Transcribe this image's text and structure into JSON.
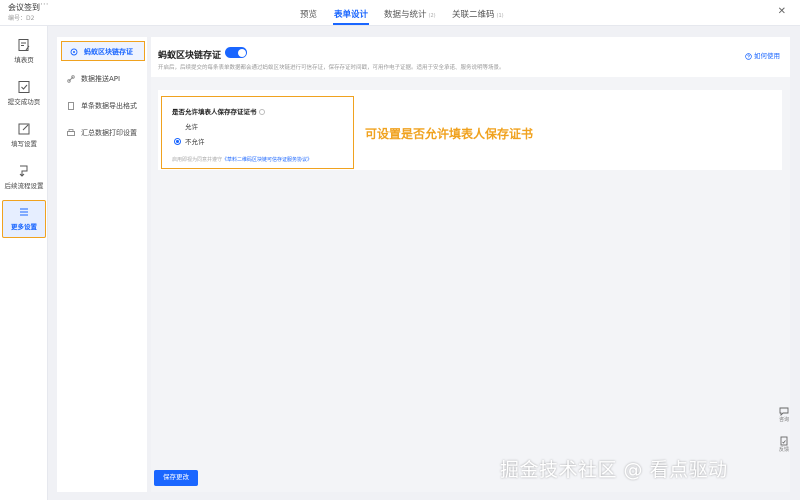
{
  "app": {
    "title": "会议签到",
    "more": "···",
    "subtitle": "编号：D2"
  },
  "tabs": [
    {
      "label": "预览",
      "badge": ""
    },
    {
      "label": "表单设计",
      "badge": ""
    },
    {
      "label": "数据与统计",
      "badge": "(2)"
    },
    {
      "label": "关联二维码",
      "badge": "(1)"
    }
  ],
  "close_glyph": "✕",
  "rail": [
    {
      "label": "填表页",
      "icon": "form-edit-icon"
    },
    {
      "label": "提交成功页",
      "icon": "success-page-icon"
    },
    {
      "label": "填写设置",
      "icon": "edit-settings-icon"
    },
    {
      "label": "后续流程设置",
      "icon": "flow-icon"
    },
    {
      "label": "更多设置",
      "icon": "menu-icon",
      "active": true
    }
  ],
  "submenu": [
    {
      "label": "蚂蚁区块链存证",
      "icon": "blockchain-icon",
      "active": true
    },
    {
      "label": "数据推送API",
      "icon": "link-icon"
    },
    {
      "label": "单条数据导出格式",
      "icon": "document-icon"
    },
    {
      "label": "汇总数据打印设置",
      "icon": "print-icon"
    }
  ],
  "section": {
    "title": "蚂蚁区块链存证",
    "enabled": true,
    "description": "开启后，后续提交的每条表单数据都会通过蚂蚁区块链进行可信存证，保存存证时间戳，可用作电子证据。适用于安全承诺、服务说明等场景。",
    "help": "如何使用"
  },
  "question": {
    "label": "是否允许填表人保存存证证书",
    "options": [
      "允许",
      "不允许"
    ],
    "selected": "不允许",
    "agree_prefix": "启用即视为同意并遵守",
    "agree_link": "《草料二维码区块链可信存证服务协议》"
  },
  "annotation": "可设置是否允许填表人保存证书",
  "save_button": "保存更改",
  "float_tools": [
    {
      "label": "咨询",
      "icon": "chat-icon"
    },
    {
      "label": "反馈",
      "icon": "feedback-icon"
    }
  ],
  "watermark": "掘金技术社区 @ 看点驱动",
  "colors": {
    "accent": "#1a66ff",
    "highlight": "#f0a21f"
  }
}
